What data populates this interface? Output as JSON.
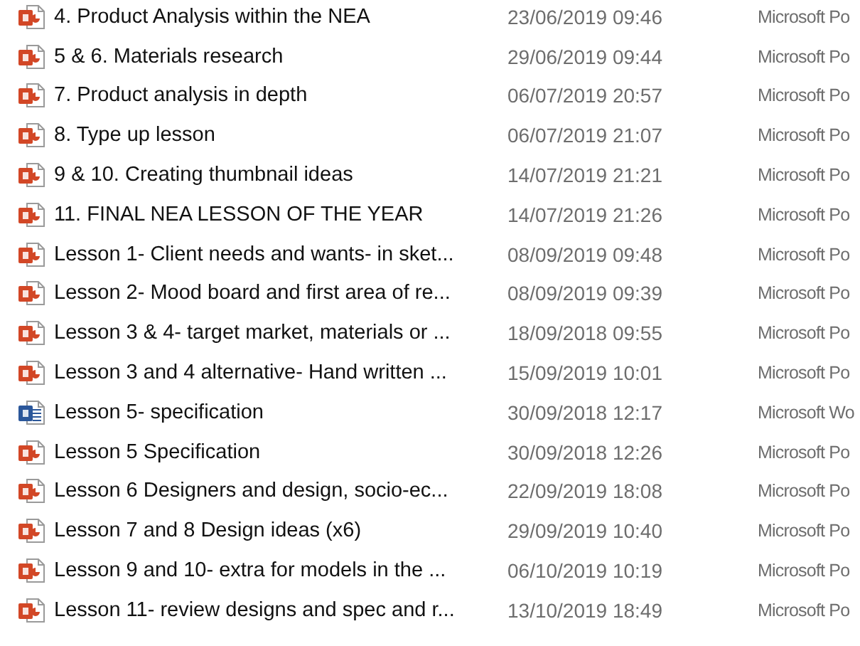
{
  "files": [
    {
      "name": "4. Product Analysis within the NEA",
      "date": "23/06/2019 09:46",
      "type": "Microsoft Po",
      "kind": "ppt"
    },
    {
      "name": "5 & 6. Materials research",
      "date": "29/06/2019 09:44",
      "type": "Microsoft Po",
      "kind": "ppt"
    },
    {
      "name": "7. Product analysis in depth",
      "date": "06/07/2019 20:57",
      "type": "Microsoft Po",
      "kind": "ppt"
    },
    {
      "name": "8. Type up lesson",
      "date": "06/07/2019 21:07",
      "type": "Microsoft Po",
      "kind": "ppt"
    },
    {
      "name": "9 & 10. Creating thumbnail ideas",
      "date": "14/07/2019 21:21",
      "type": "Microsoft Po",
      "kind": "ppt"
    },
    {
      "name": "11. FINAL NEA LESSON OF THE YEAR",
      "date": "14/07/2019 21:26",
      "type": "Microsoft Po",
      "kind": "ppt"
    },
    {
      "name": "Lesson 1- Client needs and wants- in sket...",
      "date": "08/09/2019 09:48",
      "type": "Microsoft Po",
      "kind": "ppt"
    },
    {
      "name": "Lesson 2- Mood board and first area of re...",
      "date": "08/09/2019 09:39",
      "type": "Microsoft Po",
      "kind": "ppt"
    },
    {
      "name": "Lesson 3 & 4- target market, materials or ...",
      "date": "18/09/2018 09:55",
      "type": "Microsoft Po",
      "kind": "ppt"
    },
    {
      "name": "Lesson 3 and 4 alternative- Hand written ...",
      "date": "15/09/2019 10:01",
      "type": "Microsoft Po",
      "kind": "ppt"
    },
    {
      "name": "Lesson 5- specification",
      "date": "30/09/2018 12:17",
      "type": "Microsoft Wo",
      "kind": "word"
    },
    {
      "name": "Lesson 5 Specification",
      "date": "30/09/2018 12:26",
      "type": "Microsoft Po",
      "kind": "ppt"
    },
    {
      "name": "Lesson 6 Designers and design, socio-ec...",
      "date": "22/09/2019 18:08",
      "type": "Microsoft Po",
      "kind": "ppt"
    },
    {
      "name": "Lesson 7 and 8 Design ideas (x6)",
      "date": "29/09/2019 10:40",
      "type": "Microsoft Po",
      "kind": "ppt"
    },
    {
      "name": "Lesson 9 and 10- extra for models in the ...",
      "date": "06/10/2019 10:19",
      "type": "Microsoft Po",
      "kind": "ppt"
    },
    {
      "name": "Lesson 11- review designs and spec and r...",
      "date": "13/10/2019 18:49",
      "type": "Microsoft Po",
      "kind": "ppt"
    }
  ]
}
